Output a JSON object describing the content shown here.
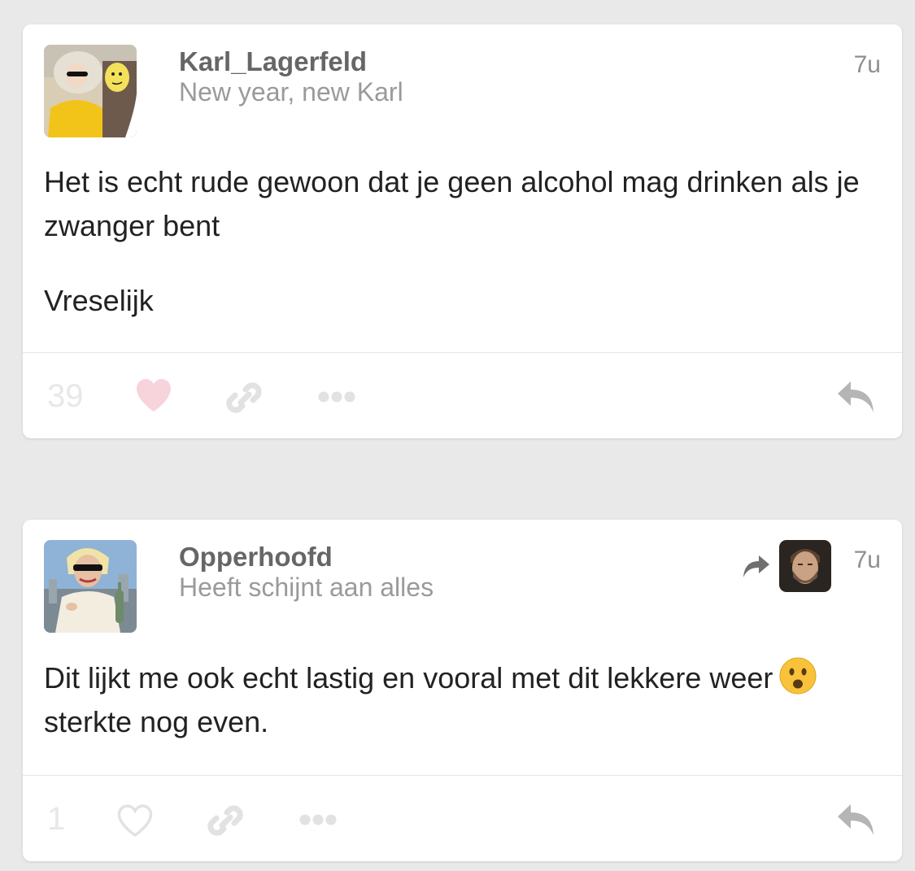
{
  "posts": [
    {
      "username": "Karl_Lagerfeld",
      "subtitle": "New year, new Karl",
      "time": "7u",
      "paragraphs": [
        "Het is echt rude gewoon dat je geen alcohol mag drinken als je zwanger bent",
        "Vreselijk"
      ],
      "likes": "39",
      "liked": true,
      "icons": [
        "heart-icon",
        "link-icon",
        "more-icon",
        "reply-icon"
      ]
    },
    {
      "username": "Opperhoofd",
      "subtitle": "Heeft schijnt aan alles",
      "time": "7u",
      "reblogged": true,
      "paragraphs": [
        "Dit lijkt me ook echt lastig en vooral met dit lekkere weer",
        "sterkte nog even."
      ],
      "emoji": "frowning-face-emoji",
      "likes": "1",
      "liked": false,
      "icons": [
        "reblog-icon",
        "heart-icon",
        "link-icon",
        "more-icon",
        "reply-icon"
      ]
    }
  ],
  "colors": {
    "background": "#e9e9e9",
    "card": "#ffffff",
    "username": "#666666",
    "subtitle": "#9a9a9a",
    "body": "#222222",
    "liked_heart": "#f7d3dc",
    "footer_icon": "#e2e2e2",
    "reply_icon": "#b5b5b5"
  }
}
